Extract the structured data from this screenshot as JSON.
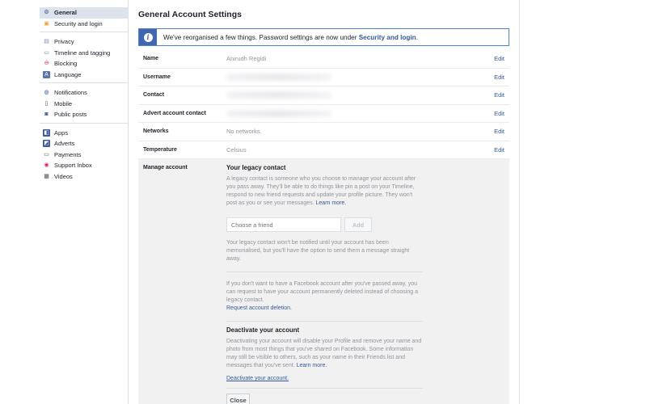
{
  "sidebar": {
    "groups": [
      [
        {
          "label": "General",
          "icon": "gears-icon",
          "active": true
        },
        {
          "label": "Security and login",
          "icon": "badge-icon"
        }
      ],
      [
        {
          "label": "Privacy",
          "icon": "lock-icon"
        },
        {
          "label": "Timeline and tagging",
          "icon": "timeline-icon"
        },
        {
          "label": "Blocking",
          "icon": "block-icon"
        },
        {
          "label": "Language",
          "icon": "language-icon"
        }
      ],
      [
        {
          "label": "Notifications",
          "icon": "globe-icon"
        },
        {
          "label": "Mobile",
          "icon": "mobile-icon"
        },
        {
          "label": "Public posts",
          "icon": "rss-icon"
        }
      ],
      [
        {
          "label": "Apps",
          "icon": "apps-icon"
        },
        {
          "label": "Adverts",
          "icon": "adverts-icon"
        },
        {
          "label": "Payments",
          "icon": "card-icon"
        },
        {
          "label": "Support Inbox",
          "icon": "lifebuoy-icon"
        },
        {
          "label": "Videos",
          "icon": "film-icon"
        }
      ]
    ]
  },
  "main": {
    "title": "General Account Settings",
    "banner": {
      "text": "We've reorganised a few things. Password settings are now under ",
      "link": "Security and login",
      "suffix": "."
    },
    "rows": [
      {
        "label": "Name",
        "value": "Anirudh Regidi",
        "blurred": false,
        "edit": "Edit"
      },
      {
        "label": "Username",
        "value": "",
        "blurred": true,
        "edit": "Edit"
      },
      {
        "label": "Contact",
        "value": "",
        "blurred": true,
        "edit": "Edit"
      },
      {
        "label": "Advert account contact",
        "value": "",
        "blurred": true,
        "edit": "Edit"
      },
      {
        "label": "Networks",
        "value": "No networks.",
        "blurred": false,
        "edit": "Edit"
      },
      {
        "label": "Temperature",
        "value": "Celsius",
        "blurred": false,
        "edit": "Edit"
      }
    ],
    "manage": {
      "label": "Manage account",
      "legacy_title": "Your legacy contact",
      "legacy_desc": "A legacy contact is someone who you choose to manage your account after you pass away. They'll be able to do things like pin a post on your Timeline, respond to new friend requests and update your profile picture. They won't post as you or see your messages.",
      "learn_more": "Learn more.",
      "friend_placeholder": "Choose a friend",
      "add_label": "Add",
      "legacy_note": "Your legacy contact won't be notified until your account has been memorialised, but you'll have the option to send them a message straight away.",
      "delete_desc": "If you don't want to have a Facebook account after you've passed away, you can request to have your account permanently deleted instead of choosing a legacy contact.",
      "delete_link": "Request account deletion.",
      "deactivate_title": "Deactivate your account",
      "deactivate_desc": "Deactivating your account will disable your Profile and remove your name and photo from most things that you've shared on Facebook. Some information may still be visible to others, such as your name in their Friends list and messages that you've sent.",
      "deactivate_learn": "Learn more.",
      "deactivate_link": "Deactivate your account.",
      "close_label": "Close"
    }
  }
}
